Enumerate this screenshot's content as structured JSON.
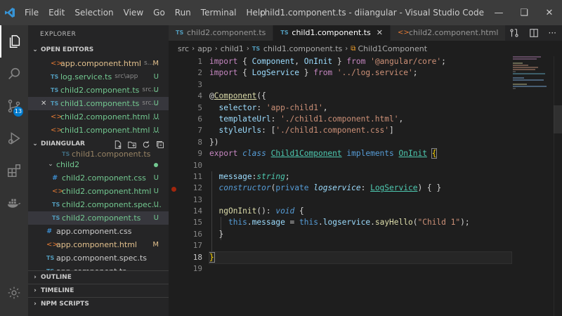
{
  "window": {
    "title": "child1.component.ts - diiangular - Visual Studio Code [Administra...",
    "menu": [
      "File",
      "Edit",
      "Selection",
      "View",
      "Go",
      "Run",
      "Terminal",
      "Help"
    ]
  },
  "activity": {
    "scm_badge": "13"
  },
  "sidebar": {
    "title": "EXPLORER",
    "open_editors_label": "OPEN EDITORS",
    "open_editors": [
      {
        "icon": "html",
        "name": "app.component.html",
        "path": "s...",
        "status": "M"
      },
      {
        "icon": "ts",
        "name": "log.service.ts",
        "path": "src\\app",
        "status": "U"
      },
      {
        "icon": "ts",
        "name": "child2.component.ts",
        "path": "src...",
        "status": "U"
      },
      {
        "icon": "ts",
        "name": "child1.component.ts",
        "path": "src...",
        "status": "U"
      },
      {
        "icon": "html",
        "name": "child2.component.html ...",
        "path": "",
        "status": "U"
      },
      {
        "icon": "html",
        "name": "child1.component.html ...",
        "path": "",
        "status": "U"
      }
    ],
    "project_label": "DIIANGULAR",
    "project_items": [
      {
        "icon": "ts",
        "name": "child1.component.ts",
        "status": ""
      },
      {
        "icon": "folder",
        "name": "child2",
        "status": ""
      },
      {
        "icon": "css",
        "name": "child2.component.css",
        "status": "U"
      },
      {
        "icon": "html",
        "name": "child2.component.html",
        "status": "U"
      },
      {
        "icon": "ts",
        "name": "child2.component.spec....",
        "status": "U"
      },
      {
        "icon": "ts",
        "name": "child2.component.ts",
        "status": "U"
      },
      {
        "icon": "css",
        "name": "app.component.css",
        "status": ""
      },
      {
        "icon": "html",
        "name": "app.component.html",
        "status": "M"
      },
      {
        "icon": "ts",
        "name": "app.component.spec.ts",
        "status": ""
      },
      {
        "icon": "ts",
        "name": "app.component.ts",
        "status": ""
      }
    ],
    "ts_tag": "TS",
    "css_tag": "#",
    "html_tag": "<>",
    "outline_label": "OUTLINE",
    "timeline_label": "TIMELINE",
    "npm_label": "NPM SCRIPTS"
  },
  "tabs": [
    {
      "icon": "ts",
      "label": "child2.component.ts",
      "active": false
    },
    {
      "icon": "ts",
      "label": "child1.component.ts",
      "active": true
    },
    {
      "icon": "html",
      "label": "child2.component.html",
      "active": false
    }
  ],
  "breadcrumb": [
    "src",
    "app",
    "child1",
    "child1.component.ts",
    "Child1Component"
  ],
  "editor": {
    "line_numbers": [
      "1",
      "2",
      "3",
      "4",
      "5",
      "6",
      "7",
      "8",
      "9",
      "10",
      "11",
      "12",
      "13",
      "14",
      "15",
      "16",
      "17",
      "18",
      "19"
    ],
    "current_line": 18
  },
  "colors": {
    "accent": "#007acc",
    "keyword": "#569cd6",
    "control": "#c586c0",
    "string": "#ce9178",
    "type": "#4ec9b0",
    "function": "#dcdcaa",
    "variable": "#9cdcfe",
    "modified": "#e2c08d",
    "untracked": "#73c991"
  },
  "icons": {
    "app": "vscode-logo-icon",
    "activity": [
      "files-icon",
      "search-icon",
      "source-control-icon",
      "run-debug-icon",
      "extensions-icon",
      "docker-icon",
      "settings-gear-icon"
    ]
  }
}
